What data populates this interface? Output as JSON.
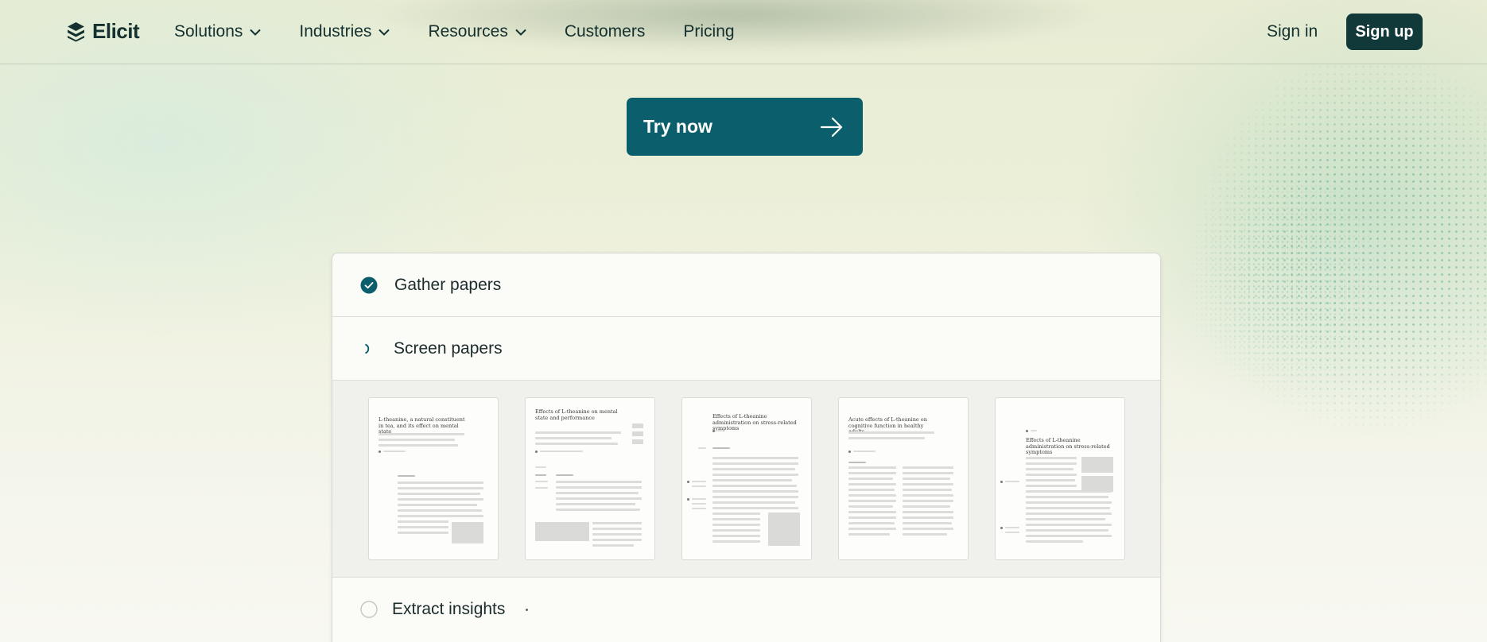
{
  "nav": {
    "logo_text": "Elicit",
    "items": [
      {
        "label": "Solutions",
        "has_dropdown": true
      },
      {
        "label": "Industries",
        "has_dropdown": true
      },
      {
        "label": "Resources",
        "has_dropdown": true
      },
      {
        "label": "Customers",
        "has_dropdown": false
      },
      {
        "label": "Pricing",
        "has_dropdown": false
      }
    ],
    "sign_in": "Sign in",
    "sign_up": "Sign up"
  },
  "cta": {
    "label": "Try now",
    "icon": "arrow-right-icon"
  },
  "workflow": {
    "steps": [
      {
        "label": "Gather papers",
        "status": "complete",
        "icon": "check-circle-icon"
      },
      {
        "label": "Screen papers",
        "status": "in-progress",
        "icon": "spinner-icon"
      },
      {
        "label": "Extract insights",
        "status": "pending",
        "icon": "empty-circle-icon"
      }
    ],
    "papers": [
      {
        "title": "L-theanine, a natural constituent in tea, and its effect on mental state"
      },
      {
        "title": "Effects of L-theanine on mental state and performance"
      },
      {
        "title": "Effects of L-theanine administration on stress-related symptoms"
      },
      {
        "title": "Acute effects of L-theanine on cognitive function in healthy adults"
      },
      {
        "title": "Effects of L-theanine administration on stress-related symptoms"
      }
    ]
  },
  "colors": {
    "primary": "#0b5f6c",
    "dark": "#11393a",
    "text": "#14302f"
  }
}
